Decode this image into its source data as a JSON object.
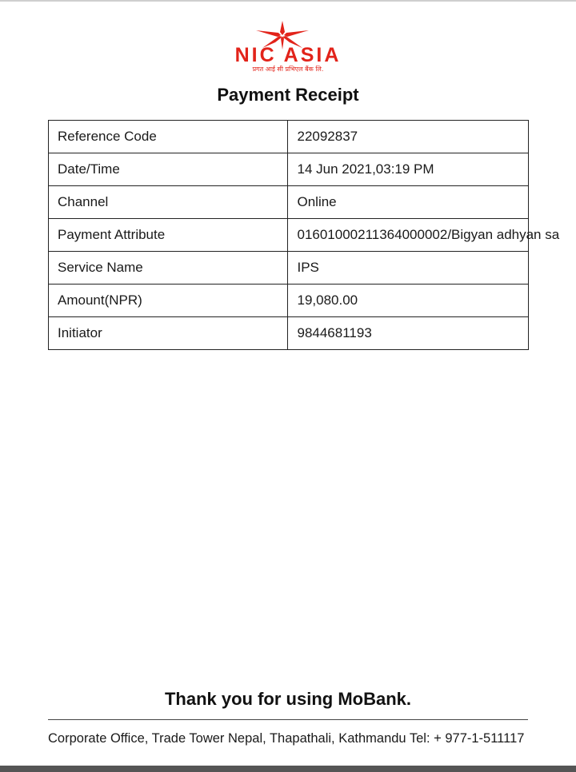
{
  "header": {
    "brand": "NIC ASIA",
    "tagline": "प्रगत आई सी प्रभिएल बैंक लि."
  },
  "title": "Payment Receipt",
  "rows": [
    {
      "label": "Reference Code",
      "value": "22092837"
    },
    {
      "label": "Date/Time",
      "value": "14 Jun 2021,03:19 PM"
    },
    {
      "label": "Channel",
      "value": "Online"
    },
    {
      "label": "Payment Attribute",
      "value": "01601000211364000002/Bigyan adhyan sa"
    },
    {
      "label": "Service Name",
      "value": "IPS"
    },
    {
      "label": "Amount(NPR)",
      "value": "19,080.00"
    },
    {
      "label": "Initiator",
      "value": "9844681193"
    }
  ],
  "thank_you": "Thank you for using MoBank.",
  "footer": "Corporate Office, Trade Tower Nepal, Thapathali, Kathmandu  Tel: + 977-1-511117",
  "colors": {
    "brand_red": "#e2231a",
    "border": "#222222"
  }
}
